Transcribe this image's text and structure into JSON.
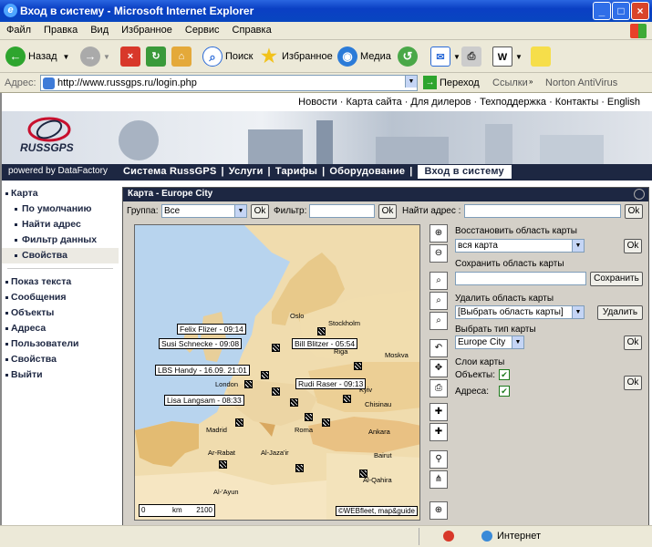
{
  "window": {
    "title": "Вход в систему - Microsoft Internet Explorer"
  },
  "menu": [
    "Файл",
    "Правка",
    "Вид",
    "Избранное",
    "Сервис",
    "Справка"
  ],
  "toolbar": {
    "back": "Назад",
    "search": "Поиск",
    "favorites": "Избранное",
    "media": "Медиа"
  },
  "address": {
    "label": "Адрес:",
    "url": "http://www.russgps.ru/login.php",
    "go": "Переход",
    "links": "Ссылки",
    "norton": "Norton AntiVirus"
  },
  "topnav": [
    "Новости",
    "Карта сайта",
    "Для дилеров",
    "Техподдержка",
    "Контакты",
    "English"
  ],
  "mainnav": {
    "powered": "powered by DataFactory",
    "items": [
      "Система RussGPS",
      "Услуги",
      "Тарифы",
      "Оборудование",
      "Вход в систему"
    ]
  },
  "sidebar": {
    "group1": [
      "Карта",
      "По умолчанию",
      "Найти адрес",
      "Фильтр данных",
      "Свойства"
    ],
    "group2": [
      "Показ текста",
      "Сообщения",
      "Объекты",
      "Адреса",
      "Пользователи",
      "Свойства",
      "Выйти"
    ]
  },
  "map": {
    "header": "Карта - Europe City",
    "group_label": "Группа:",
    "group_value": "Все",
    "ok": "Ok",
    "filter_label": "Фильтр:",
    "address_label": "Найти адрес :",
    "labels": [
      "Felix Flizer - 09:14",
      "Susi Schnecke - 09:08",
      "Bill Blitzer - 05:54",
      "LBS Handy - 16.09. 21:01",
      "Rudi Raser - 09:13",
      "Lisa Langsam - 08:33"
    ],
    "cities": [
      "Oslo",
      "Stockholm",
      "Riga",
      "Moskva",
      "London",
      "Kyiv",
      "Chisinau",
      "Madrid",
      "Roma",
      "Ankara",
      "Ar-Rabat",
      "Al-Jaza'ir",
      "Bairut",
      "Al-Qahira",
      "Al-'Ayun"
    ],
    "scale_left": "0",
    "scale_mid": "km",
    "scale_right": "2100",
    "copyright": "©WEBfleet, map&guide"
  },
  "panel": {
    "restore_label": "Восстановить область карты",
    "restore_value": "вся карта",
    "save_label": "Сохранить область карты",
    "save_button": "Сохранить",
    "delete_label": "Удалить область карты",
    "delete_value": "[Выбрать область карты]",
    "delete_button": "Удалить",
    "type_label": "Выбрать тип карты",
    "type_value": "Europe City",
    "layers_label": "Слои карты",
    "objects_label": "Объекты:",
    "addresses_label": "Адреса:"
  },
  "status": {
    "zone": "Интернет"
  },
  "colors": {
    "nav": "#1d2742",
    "titlebar": "#0a3fc4",
    "accent": "#c8102e"
  }
}
